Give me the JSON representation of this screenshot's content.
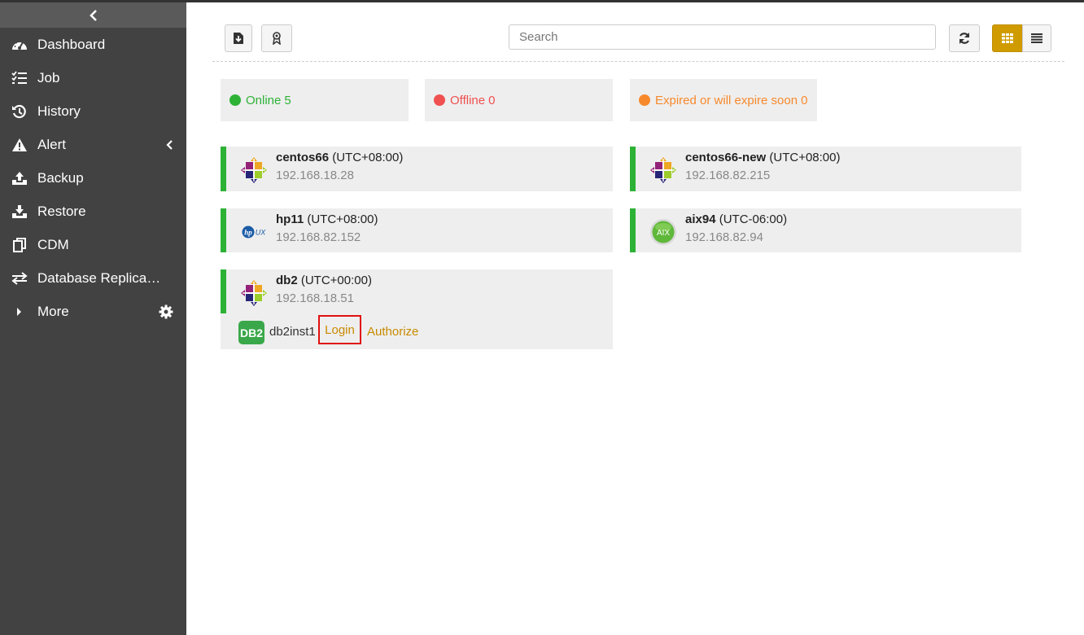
{
  "sidebar": {
    "items": [
      {
        "label": "Dashboard",
        "icon": "dashboard-icon"
      },
      {
        "label": "Job",
        "icon": "job-list-icon"
      },
      {
        "label": "History",
        "icon": "history-icon"
      },
      {
        "label": "Alert",
        "icon": "alert-icon"
      },
      {
        "label": "Backup",
        "icon": "upload-icon"
      },
      {
        "label": "Restore",
        "icon": "download-icon"
      },
      {
        "label": "CDM",
        "icon": "copy-icon"
      },
      {
        "label": "Database Replication",
        "icon": "exchange-icon"
      },
      {
        "label": "More",
        "icon": "caret-right-icon"
      }
    ]
  },
  "toolbar": {
    "search_placeholder": "Search"
  },
  "status": {
    "online_label": "Online",
    "online_count": "5",
    "offline_label": "Offline",
    "offline_count": "0",
    "expired_label": "Expired or will expire soon",
    "expired_count": "0"
  },
  "hosts": [
    {
      "name": "centos66",
      "tz": "(UTC+08:00)",
      "ip": "192.168.18.28",
      "os": "centos"
    },
    {
      "name": "centos66-new",
      "tz": "(UTC+08:00)",
      "ip": "192.168.82.215",
      "os": "centos"
    },
    {
      "name": "hp11",
      "tz": "(UTC+08:00)",
      "ip": "192.168.82.152",
      "os": "hpux"
    },
    {
      "name": "aix94",
      "tz": "(UTC-06:00)",
      "ip": "192.168.82.94",
      "os": "aix"
    },
    {
      "name": "db2",
      "tz": "(UTC+00:00)",
      "ip": "192.168.18.51",
      "os": "centos"
    }
  ],
  "db_instance": {
    "badge": "DB2",
    "name": "db2inst1",
    "login_label": "Login",
    "authorize_label": "Authorize"
  },
  "logos": {
    "aix_text": "AIX",
    "hpux_text": "UX"
  },
  "colors": {
    "sidebar_bg": "#424242",
    "accent": "#d09b00",
    "online": "#2db236",
    "offline": "#f05050",
    "expired": "#f7892c"
  }
}
